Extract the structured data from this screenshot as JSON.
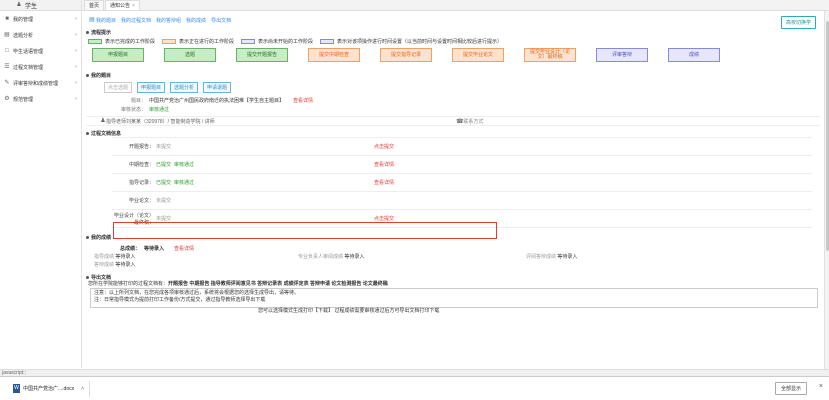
{
  "sidebar": {
    "header": "学生",
    "items": [
      {
        "label": "我的管理",
        "icon": "user-icon"
      },
      {
        "label": "选题分析",
        "icon": "chart-icon"
      },
      {
        "label": "毕生话语管理",
        "icon": "message-icon"
      },
      {
        "label": "过程文档管理",
        "icon": "doc-icon"
      },
      {
        "label": "评审答辩和成绩管理",
        "icon": "grade-icon"
      },
      {
        "label": "规范管理",
        "icon": "gear-icon"
      }
    ]
  },
  "tabs": [
    {
      "label": "首页"
    },
    {
      "label": "通知公告"
    }
  ],
  "toolbar": {
    "items": [
      "我的题目",
      "我的过程文档",
      "我的答辩组",
      "我的成绩",
      "导出文档"
    ],
    "switch_label": "高校切换学"
  },
  "progress": {
    "title": "流程提示",
    "legend": [
      {
        "text": "表示已完成的工作阶段",
        "color": "#c8ecc8"
      },
      {
        "text": "表示正在进行的工作阶段",
        "color": "#fde3cf"
      },
      {
        "text": "表示尚未开始的工作阶段",
        "color": "#e6e6ff"
      },
      {
        "text": "表示对该项操作进行时间设置（以当前时间与设置时间相比较后进行提示）",
        "color": "#e6e6ff"
      }
    ],
    "steps": [
      {
        "label": "申报题目",
        "state": "done"
      },
      {
        "label": "选题",
        "state": "done"
      },
      {
        "label": "提交开题报告",
        "state": "done"
      },
      {
        "label": "提交中期检查",
        "state": "cur"
      },
      {
        "label": "提交指导记录",
        "state": "cur"
      },
      {
        "label": "提交毕业论文",
        "state": "cur"
      },
      {
        "label": "提交毕业设计（论文）最终稿",
        "state": "cur"
      },
      {
        "label": "评审答辩",
        "state": "todo"
      },
      {
        "label": "成绩",
        "state": "todo"
      }
    ]
  },
  "topic": {
    "title": "我的题目",
    "buttons": [
      "点击选题",
      "申报题目",
      "选题分析",
      "申请退题"
    ],
    "name_key": "题目：",
    "name_value": "中国共产党治广州国民政府南迁的执法困难【学生自主题目】",
    "name_action": "查看详情",
    "status_key": "审核状态：",
    "status_value": "审核通过",
    "teacher": "指导老师刘某某（320978）/ 智能制造学院 / 讲师",
    "contact": "联系方式"
  },
  "process": {
    "title": "过程文档信息",
    "rows": [
      {
        "key": "开题报告：",
        "status": "未提交",
        "review": "",
        "action": "点击提交",
        "action_color": "red"
      },
      {
        "key": "中期检查：",
        "status": "已提交",
        "review": "审核通过",
        "action": "查看详情",
        "action_color": "red"
      },
      {
        "key": "指导记录：",
        "status": "已提交",
        "review": "审核通过",
        "action": "查看详情",
        "action_color": "red"
      },
      {
        "key": "毕业论文：",
        "status": "未提交",
        "review": "",
        "action": "",
        "action_color": "red"
      },
      {
        "key": "毕业设计（论文）最终稿：",
        "status": "未提交",
        "review": "",
        "action": "点击提交",
        "action_color": "red"
      }
    ]
  },
  "score": {
    "title": "我的成绩",
    "total_key": "总成绩：",
    "total_value": "等待录入",
    "total_action": "查看详情",
    "parts": [
      {
        "key": "指导成绩",
        "value": "等待录入"
      },
      {
        "key": "专业负责人审阅成绩",
        "value": "等待录入"
      },
      {
        "key": "评阅答辩成绩",
        "value": "等待录入"
      },
      {
        "key": "答辩成绩",
        "value": "等待录入"
      }
    ]
  },
  "docs": {
    "title": "导出文档",
    "line1_prefix": "您所在学院能够打印的过程文档有：",
    "line1_items": "开题报告 中期报告 指导教师评阅意见书 答辩记录表 成绩评定表 答辩申请 论文检测报告 论文最终稿",
    "line2": "注意：以上所列文档，在您完成各项审核通过后，系统将会根据您的选择生成导出，请等待。",
    "line3": "注：日常指导模式为提前打印工作备份/方式提交，通过指导教师选择导出下载",
    "footer": "您可以选择模式生成打印【下载】 过程成绩需要审核通过后方可导出文档打印下载"
  },
  "status_text": "javascript:;",
  "download": {
    "file": "中国共产党治广....docx",
    "show_all": "全部显示"
  }
}
